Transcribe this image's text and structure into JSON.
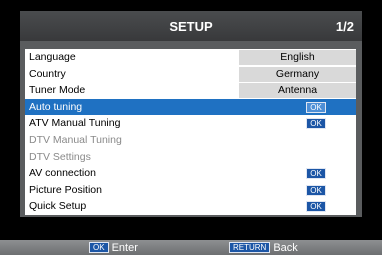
{
  "header": {
    "title": "SETUP",
    "page": "1/2"
  },
  "menu": {
    "items": [
      {
        "label": "Language",
        "value": "English"
      },
      {
        "label": "Country",
        "value": "Germany"
      },
      {
        "label": "Tuner Mode",
        "value": "Antenna"
      },
      {
        "label": "Auto tuning",
        "badge": "OK"
      },
      {
        "label": "ATV Manual Tuning",
        "badge": "OK"
      },
      {
        "label": "DTV Manual Tuning"
      },
      {
        "label": "DTV Settings"
      },
      {
        "label": "AV connection",
        "badge": "OK"
      },
      {
        "label": "Picture Position",
        "badge": "OK"
      },
      {
        "label": "Quick Setup",
        "badge": "OK"
      }
    ]
  },
  "footer": {
    "enter_key": "OK",
    "enter_label": "Enter",
    "back_key": "RETURN",
    "back_label": "Back"
  }
}
